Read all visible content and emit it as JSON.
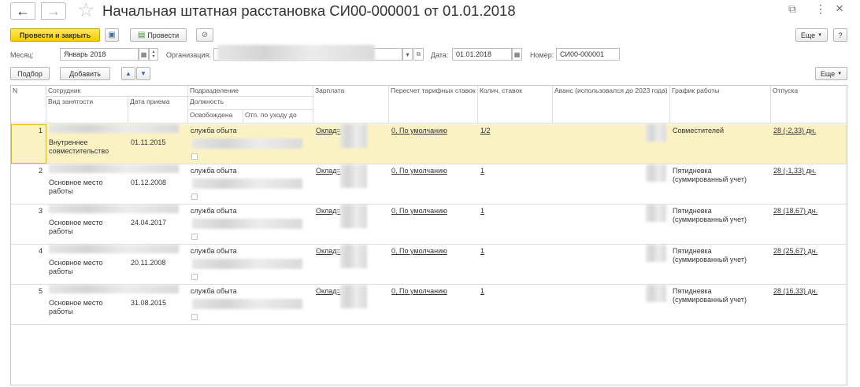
{
  "header": {
    "title": "Начальная штатная расстановка СИ00-000001 от 01.01.2018",
    "back_icon": "←",
    "forward_icon": "→",
    "star_icon": "☆",
    "link_icon": "⧉",
    "more_icon": "⋮",
    "close_icon": "×"
  },
  "toolbar": {
    "post_close_label": "Провести и закрыть",
    "save_icon": "▣",
    "post_label": "Провести",
    "attach_icon": "✂",
    "more_label": "Еще",
    "help_label": "?"
  },
  "fields": {
    "month_label": "Месяц:",
    "month_value": "Январь 2018",
    "org_label": "Организация:",
    "date_label": "Дата:",
    "date_value": "01.01.2018",
    "number_label": "Номер:",
    "number_value": "СИ00-000001"
  },
  "table_toolbar": {
    "pick_label": "Подбор",
    "add_label": "Добавить",
    "up_icon": "▲",
    "down_icon": "▼",
    "more_label": "Еще"
  },
  "columns": {
    "n": "N",
    "employee": "Сотрудник",
    "employment_type": "Вид занятости",
    "hire_date": "Дата приема",
    "department": "Подразделение",
    "position": "Должность",
    "released": "Освобождена",
    "parental_leave": "Отп. по уходу до",
    "salary": "Зарплата",
    "tariff_recalc": "Пересчет тарифных ставок",
    "rates_count": "Колич. ставок",
    "advance": "Аванс (использовался до 2023 года)",
    "schedule": "График работы",
    "vacations": "Отпуска"
  },
  "rows": [
    {
      "n": "1",
      "employment_type": "Внутреннее совместительство",
      "hire_date": "01.11.2015",
      "department": "служба обыта",
      "salary": "Оклад=",
      "tariff": "0, По умолчанию",
      "rates": "1/2",
      "schedule": "Совместителей",
      "vacation": "28 (-2,33) дн."
    },
    {
      "n": "2",
      "employment_type": "Основное место работы",
      "hire_date": "01.12.2008",
      "department": "служба обыта",
      "salary": "Оклад=",
      "tariff": "0, По умолчанию",
      "rates": "1",
      "schedule": "Пятидневка (суммированный учет)",
      "vacation": "28 (-1,33) дн."
    },
    {
      "n": "3",
      "employment_type": "Основное место работы",
      "hire_date": "24.04.2017",
      "department": "служба обыта",
      "salary": "Оклад=",
      "tariff": "0, По умолчанию",
      "rates": "1",
      "schedule": "Пятидневка (суммированный учет)",
      "vacation": "28 (18,67) дн."
    },
    {
      "n": "4",
      "employment_type": "Основное место работы",
      "hire_date": "20.11.2008",
      "department": "служба обыта",
      "salary": "Оклад=",
      "tariff": "0, По умолчанию",
      "rates": "1",
      "schedule": "Пятидневка (суммированный учет)",
      "vacation": "28 (25,67) дн."
    },
    {
      "n": "5",
      "employment_type": "Основное место работы",
      "hire_date": "31.08.2015",
      "department": "служба обыта",
      "salary": "Оклад=",
      "tariff": "0, По умолчанию",
      "rates": "1",
      "schedule": "Пятидневка (суммированный учет)",
      "vacation": "28 (16,33) дн."
    }
  ]
}
